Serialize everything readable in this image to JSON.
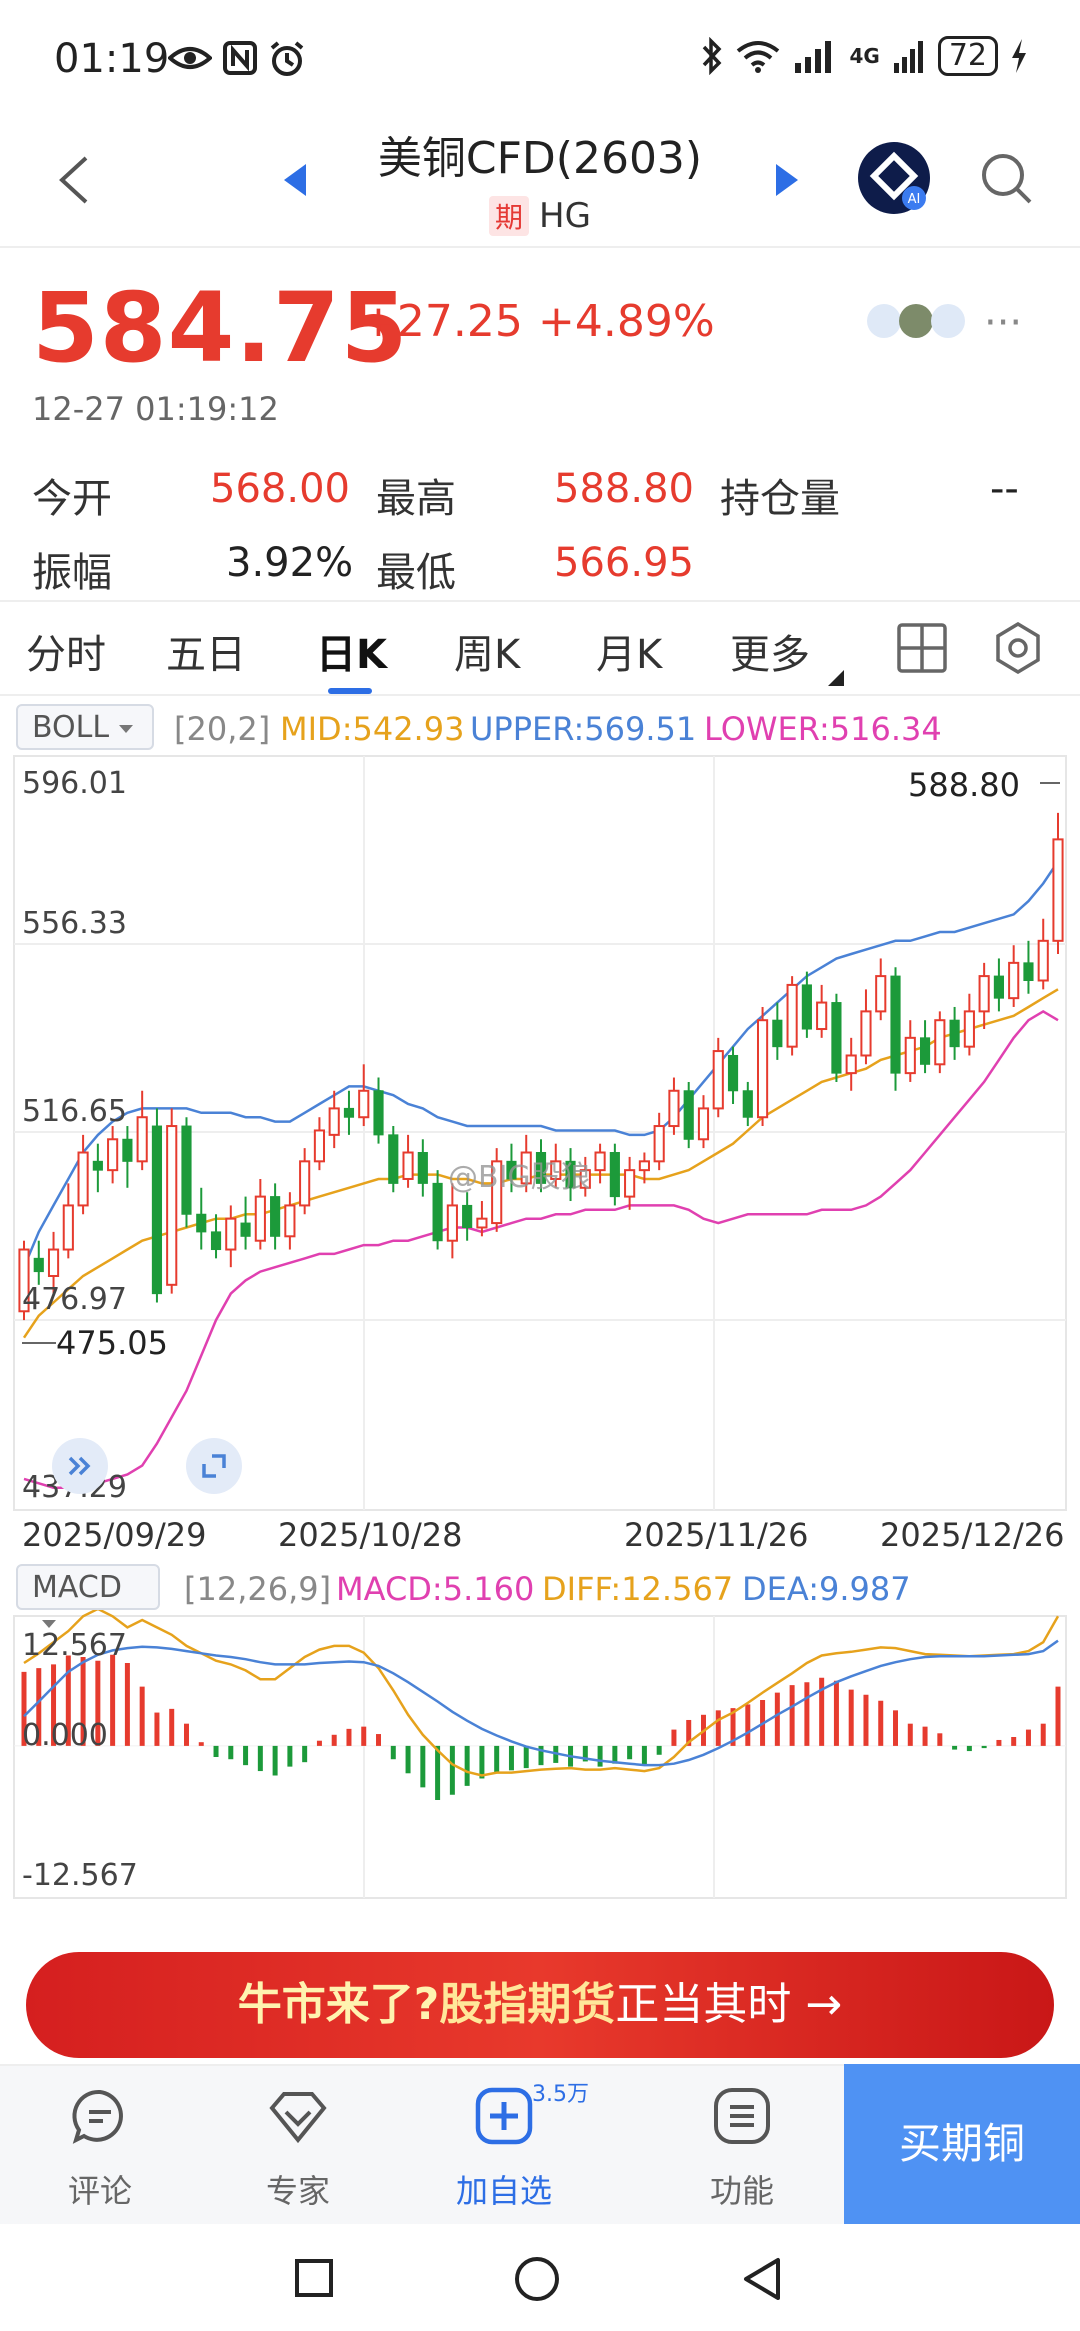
{
  "status_bar": {
    "time": "01:19",
    "battery": "72",
    "network": "4G"
  },
  "header": {
    "title": "美铜CFD(2603)",
    "tag": "期",
    "code": "HG"
  },
  "quote": {
    "price": "584.75",
    "change": "+27.25",
    "change_pct": "+4.89%",
    "timestamp": "12-27 01:19:12",
    "stats": [
      {
        "label": "今开",
        "value": "568.00"
      },
      {
        "label": "最高",
        "value": "588.80"
      },
      {
        "label": "持仓量",
        "value": "--"
      },
      {
        "label": "振幅",
        "value": "3.92%"
      },
      {
        "label": "最低",
        "value": "566.95"
      }
    ]
  },
  "tabs": [
    "分时",
    "五日",
    "日K",
    "周K",
    "月K",
    "更多"
  ],
  "active_tab": "日K",
  "boll": {
    "name": "BOLL",
    "params": "[20,2]",
    "mid": "MID:542.93",
    "upper": "UPPER:569.51",
    "lower": "LOWER:516.34"
  },
  "macd": {
    "name": "MACD",
    "params": "[12,26,9]",
    "macd": "MACD:5.160",
    "diff": "DIFF:12.567",
    "dea": "DEA:9.987"
  },
  "watermark": "@BIG股狼",
  "banner": {
    "part1": "牛市来了?",
    "part2": "股指期货",
    "part3": "正当其时",
    "arrow": "→"
  },
  "bottom_bar": {
    "comment": "评论",
    "expert": "专家",
    "add": "加自选",
    "add_count": "3.5万",
    "function": "功能",
    "buy": "买期铜"
  },
  "colors": {
    "up": "#e63b2e",
    "down": "#1c9a3a",
    "mid": "#e6a21c",
    "upper": "#4a82d6",
    "lower": "#e040b0",
    "accent": "#2d6ee5"
  },
  "chart_data": [
    {
      "type": "candlestick",
      "title": "",
      "y_tick_labels": [
        "596.01",
        "556.33",
        "516.65",
        "476.97",
        "437.29"
      ],
      "ylim": [
        437.29,
        596.01
      ],
      "x_tick_labels": [
        "2025/09/29",
        "2025/10/28",
        "2025/11/26",
        "2025/12/26"
      ],
      "max_marker": "588.80",
      "min_marker": "475.05",
      "candles": [
        {
          "o": 476,
          "c": 490,
          "h": 492,
          "l": 474
        },
        {
          "o": 488,
          "c": 485,
          "h": 492,
          "l": 482
        },
        {
          "o": 484,
          "c": 490,
          "h": 494,
          "l": 480
        },
        {
          "o": 490,
          "c": 500,
          "h": 505,
          "l": 488
        },
        {
          "o": 500,
          "c": 512,
          "h": 516,
          "l": 498
        },
        {
          "o": 510,
          "c": 508,
          "h": 514,
          "l": 503
        },
        {
          "o": 508,
          "c": 515,
          "h": 518,
          "l": 505
        },
        {
          "o": 515,
          "c": 510,
          "h": 518,
          "l": 504
        },
        {
          "o": 510,
          "c": 520,
          "h": 526,
          "l": 508
        },
        {
          "o": 518,
          "c": 480,
          "h": 522,
          "l": 478
        },
        {
          "o": 482,
          "c": 518,
          "h": 522,
          "l": 480
        },
        {
          "o": 518,
          "c": 498,
          "h": 520,
          "l": 495
        },
        {
          "o": 498,
          "c": 494,
          "h": 504,
          "l": 490
        },
        {
          "o": 494,
          "c": 490,
          "h": 498,
          "l": 488
        },
        {
          "o": 490,
          "c": 497,
          "h": 500,
          "l": 486
        },
        {
          "o": 496,
          "c": 493,
          "h": 502,
          "l": 490
        },
        {
          "o": 492,
          "c": 502,
          "h": 506,
          "l": 490
        },
        {
          "o": 502,
          "c": 493,
          "h": 505,
          "l": 490
        },
        {
          "o": 493,
          "c": 500,
          "h": 503,
          "l": 490
        },
        {
          "o": 500,
          "c": 510,
          "h": 513,
          "l": 498
        },
        {
          "o": 510,
          "c": 517,
          "h": 520,
          "l": 508
        },
        {
          "o": 516,
          "c": 522,
          "h": 526,
          "l": 513
        },
        {
          "o": 522,
          "c": 520,
          "h": 526,
          "l": 516
        },
        {
          "o": 520,
          "c": 526,
          "h": 532,
          "l": 518
        },
        {
          "o": 526,
          "c": 516,
          "h": 529,
          "l": 514
        },
        {
          "o": 516,
          "c": 505,
          "h": 518,
          "l": 503
        },
        {
          "o": 506,
          "c": 512,
          "h": 516,
          "l": 504
        },
        {
          "o": 512,
          "c": 505,
          "h": 515,
          "l": 502
        },
        {
          "o": 505,
          "c": 492,
          "h": 508,
          "l": 490
        },
        {
          "o": 492,
          "c": 500,
          "h": 505,
          "l": 488
        },
        {
          "o": 500,
          "c": 495,
          "h": 503,
          "l": 492
        },
        {
          "o": 495,
          "c": 497,
          "h": 501,
          "l": 493
        },
        {
          "o": 496,
          "c": 510,
          "h": 513,
          "l": 494
        },
        {
          "o": 510,
          "c": 506,
          "h": 514,
          "l": 503
        },
        {
          "o": 505,
          "c": 512,
          "h": 516,
          "l": 503
        },
        {
          "o": 512,
          "c": 505,
          "h": 515,
          "l": 503
        },
        {
          "o": 506,
          "c": 510,
          "h": 514,
          "l": 504
        },
        {
          "o": 510,
          "c": 504,
          "h": 513,
          "l": 501
        },
        {
          "o": 504,
          "c": 508,
          "h": 511,
          "l": 502
        },
        {
          "o": 508,
          "c": 512,
          "h": 514,
          "l": 505
        },
        {
          "o": 512,
          "c": 502,
          "h": 514,
          "l": 500
        },
        {
          "o": 502,
          "c": 508,
          "h": 511,
          "l": 499
        },
        {
          "o": 508,
          "c": 510,
          "h": 512,
          "l": 505
        },
        {
          "o": 510,
          "c": 518,
          "h": 521,
          "l": 508
        },
        {
          "o": 518,
          "c": 526,
          "h": 529,
          "l": 516
        },
        {
          "o": 526,
          "c": 515,
          "h": 528,
          "l": 513
        },
        {
          "o": 515,
          "c": 522,
          "h": 525,
          "l": 513
        },
        {
          "o": 522,
          "c": 535,
          "h": 538,
          "l": 520
        },
        {
          "o": 534,
          "c": 526,
          "h": 536,
          "l": 523
        },
        {
          "o": 526,
          "c": 520,
          "h": 528,
          "l": 518
        },
        {
          "o": 520,
          "c": 542,
          "h": 545,
          "l": 518
        },
        {
          "o": 542,
          "c": 536,
          "h": 546,
          "l": 533
        },
        {
          "o": 536,
          "c": 550,
          "h": 552,
          "l": 534
        },
        {
          "o": 550,
          "c": 540,
          "h": 553,
          "l": 538
        },
        {
          "o": 540,
          "c": 546,
          "h": 550,
          "l": 538
        },
        {
          "o": 546,
          "c": 530,
          "h": 548,
          "l": 528
        },
        {
          "o": 530,
          "c": 534,
          "h": 538,
          "l": 526
        },
        {
          "o": 534,
          "c": 544,
          "h": 549,
          "l": 532
        },
        {
          "o": 544,
          "c": 552,
          "h": 556,
          "l": 542
        },
        {
          "o": 552,
          "c": 530,
          "h": 554,
          "l": 526
        },
        {
          "o": 530,
          "c": 538,
          "h": 542,
          "l": 528
        },
        {
          "o": 538,
          "c": 532,
          "h": 542,
          "l": 530
        },
        {
          "o": 532,
          "c": 542,
          "h": 544,
          "l": 530
        },
        {
          "o": 542,
          "c": 536,
          "h": 545,
          "l": 533
        },
        {
          "o": 536,
          "c": 544,
          "h": 548,
          "l": 534
        },
        {
          "o": 544,
          "c": 552,
          "h": 555,
          "l": 540
        },
        {
          "o": 552,
          "c": 547,
          "h": 556,
          "l": 544
        },
        {
          "o": 547,
          "c": 555,
          "h": 559,
          "l": 545
        },
        {
          "o": 555,
          "c": 551,
          "h": 560,
          "l": 548
        },
        {
          "o": 551,
          "c": 560,
          "h": 565,
          "l": 549
        },
        {
          "o": 560,
          "c": 583,
          "h": 589,
          "l": 557
        }
      ],
      "series": [
        {
          "name": "MID",
          "values": [
            470,
            475,
            478,
            481,
            484,
            486,
            488,
            490,
            492,
            493,
            494,
            495,
            496,
            497,
            497,
            498,
            498,
            499,
            500,
            501,
            502,
            503,
            504,
            505,
            506,
            506,
            507,
            507,
            507,
            506,
            506,
            505,
            505,
            506,
            506,
            507,
            507,
            507,
            507,
            507,
            507,
            507,
            506,
            506,
            507,
            508,
            510,
            512,
            514,
            517,
            520,
            522,
            524,
            526,
            528,
            529,
            530,
            531,
            533,
            534,
            535,
            536,
            538,
            539,
            540,
            541,
            542,
            543,
            545,
            547,
            549
          ]
        },
        {
          "name": "UPPER",
          "values": [
            486,
            494,
            500,
            506,
            512,
            516,
            519,
            521,
            522,
            522,
            522,
            522,
            521,
            521,
            521,
            520,
            520,
            519,
            519,
            521,
            523,
            525,
            527,
            527,
            526,
            525,
            523,
            522,
            520,
            519,
            518,
            518,
            518,
            518,
            518,
            518,
            517,
            517,
            517,
            517,
            517,
            516,
            516,
            517,
            520,
            524,
            528,
            532,
            536,
            540,
            543,
            546,
            549,
            552,
            554,
            556,
            557,
            558,
            559,
            560,
            560,
            561,
            562,
            562,
            563,
            564,
            565,
            566,
            569,
            573,
            578
          ]
        },
        {
          "name": "LOWER",
          "values": [
            438,
            437,
            436,
            436,
            436,
            437,
            438,
            439,
            441,
            446,
            452,
            458,
            466,
            474,
            480,
            483,
            485,
            486,
            487,
            488,
            489,
            489,
            490,
            491,
            491,
            492,
            492,
            493,
            494,
            495,
            495,
            494,
            495,
            496,
            497,
            497,
            498,
            498,
            499,
            499,
            499,
            500,
            500,
            500,
            500,
            499,
            497,
            496,
            497,
            498,
            498,
            498,
            498,
            498,
            499,
            499,
            499,
            500,
            502,
            505,
            508,
            512,
            516,
            520,
            524,
            528,
            533,
            538,
            542,
            544,
            542
          ]
        }
      ]
    },
    {
      "type": "bar",
      "title": "",
      "y_tick_labels": [
        "12.567",
        "0.000",
        "-12.567"
      ],
      "ylim": [
        -20,
        17
      ],
      "histogram": [
        10.0,
        10.5,
        11.0,
        12.2,
        12.0,
        11.5,
        12.3,
        11.2,
        8.0,
        4.5,
        5.0,
        3.0,
        0.5,
        -1.5,
        -1.8,
        -2.6,
        -3.4,
        -4.0,
        -2.8,
        -2.2,
        0.7,
        1.5,
        2.3,
        2.6,
        1.6,
        -1.8,
        -3.7,
        -5.6,
        -7.3,
        -6.6,
        -5.4,
        -4.4,
        -3.6,
        -3.3,
        -3.0,
        -2.6,
        -2.3,
        -2.8,
        -2.1,
        -2.8,
        -2.4,
        -1.8,
        -2.5,
        -1.2,
        2.2,
        3.5,
        4.2,
        4.8,
        5.1,
        5.6,
        6.2,
        7.2,
        8.2,
        8.6,
        9.2,
        8.8,
        7.6,
        6.9,
        6.1,
        4.8,
        3.0,
        2.6,
        1.7,
        -0.5,
        -0.7,
        -0.3,
        0.8,
        1.2,
        2.2,
        3.0,
        8.0
      ],
      "series": [
        {
          "name": "DIFF",
          "values": [
            11.2,
            12.5,
            14.0,
            15.5,
            17.5,
            18.5,
            17.5,
            16.0,
            17.0,
            16.0,
            15.0,
            13.5,
            12.5,
            11.5,
            11.0,
            10.2,
            9.0,
            9.0,
            10.5,
            12.0,
            13.0,
            13.5,
            13.5,
            12.6,
            10.5,
            7.5,
            4.2,
            1.5,
            -0.6,
            -2.5,
            -3.5,
            -4.0,
            -3.6,
            -3.6,
            -3.4,
            -3.2,
            -3.1,
            -3.0,
            -3.2,
            -3.2,
            -3.0,
            -3.2,
            -3.4,
            -3.0,
            -1.5,
            0.5,
            2.0,
            3.5,
            4.5,
            5.8,
            7.2,
            8.5,
            9.8,
            11.2,
            12.2,
            12.5,
            12.7,
            13.0,
            13.3,
            13.2,
            12.8,
            12.4,
            12.3,
            12.2,
            12.1,
            12.2,
            12.3,
            12.4,
            12.8,
            14.0,
            17.5
          ]
        },
        {
          "name": "DEA",
          "values": [
            4.0,
            6.0,
            8.0,
            10.0,
            11.3,
            12.3,
            12.9,
            13.2,
            13.4,
            13.3,
            13.1,
            12.8,
            12.5,
            12.2,
            12.0,
            11.7,
            11.3,
            11.0,
            11.0,
            11.0,
            11.2,
            11.3,
            11.4,
            11.3,
            10.8,
            9.8,
            8.6,
            7.3,
            6.0,
            4.6,
            3.4,
            2.3,
            1.4,
            0.6,
            -0.1,
            -0.6,
            -1.0,
            -1.4,
            -1.7,
            -2.0,
            -2.2,
            -2.4,
            -2.6,
            -2.6,
            -2.4,
            -1.9,
            -1.2,
            -0.3,
            0.7,
            1.8,
            3.0,
            4.2,
            5.3,
            6.5,
            7.6,
            8.6,
            9.4,
            10.1,
            10.8,
            11.3,
            11.7,
            12.0,
            12.1,
            12.1,
            12.1,
            12.1,
            12.2,
            12.3,
            12.4,
            12.8,
            14.2
          ]
        }
      ]
    }
  ]
}
